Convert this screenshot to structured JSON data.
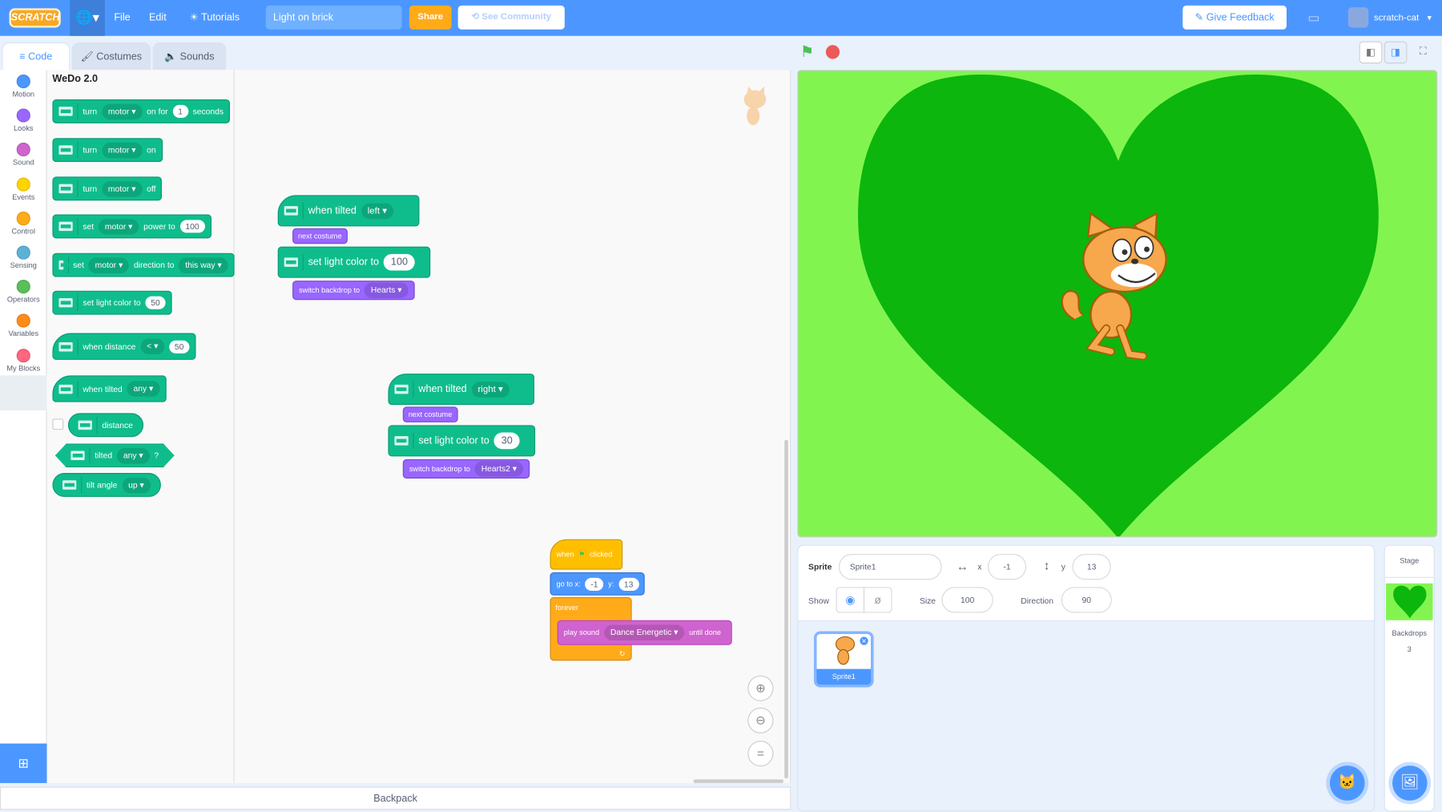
{
  "menu": {
    "logo": "Scratch",
    "file": "File",
    "edit": "Edit",
    "tutorials": "Tutorials",
    "project_title": "Light on brick",
    "share": "Share",
    "see_community": "See Community",
    "give_feedback": "Give Feedback",
    "username": "scratch-cat"
  },
  "tabs": {
    "code": "Code",
    "costumes": "Costumes",
    "sounds": "Sounds"
  },
  "categories": [
    {
      "label": "Motion",
      "color": "#4c97ff"
    },
    {
      "label": "Looks",
      "color": "#9966ff"
    },
    {
      "label": "Sound",
      "color": "#cf63cf"
    },
    {
      "label": "Events",
      "color": "#ffd500"
    },
    {
      "label": "Control",
      "color": "#ffab19"
    },
    {
      "label": "Sensing",
      "color": "#5cb1d6"
    },
    {
      "label": "Operators",
      "color": "#59c059"
    },
    {
      "label": "Variables",
      "color": "#ff8c1a"
    },
    {
      "label": "My Blocks",
      "color": "#ff6680"
    },
    {
      "label": "WeDo 2.0",
      "color": "#0fbd8c"
    }
  ],
  "palette": {
    "heading": "WeDo 2.0",
    "b1": {
      "a": "turn",
      "dd": "motor",
      "b": "on for",
      "num": "1",
      "c": "seconds"
    },
    "b2": {
      "a": "turn",
      "dd": "motor",
      "b": "on"
    },
    "b3": {
      "a": "turn",
      "dd": "motor",
      "b": "off"
    },
    "b4": {
      "a": "set",
      "dd": "motor",
      "b": "power to",
      "num": "100"
    },
    "b5": {
      "a": "set",
      "dd": "motor",
      "b": "direction to",
      "dd2": "this way"
    },
    "b6": {
      "a": "set light color to",
      "num": "50"
    },
    "b7": {
      "a": "when distance",
      "dd": "<",
      "num": "50"
    },
    "b8": {
      "a": "when tilted",
      "dd": "any"
    },
    "b9": {
      "a": "distance"
    },
    "b10": {
      "a": "tilted",
      "dd": "any",
      "b": "?"
    },
    "b11": {
      "a": "tilt angle",
      "dd": "up"
    }
  },
  "scripts": {
    "s1": {
      "hat": "when tilted",
      "hat_dd": "left",
      "looks": "next costume",
      "light": "set light color to",
      "light_num": "100",
      "backdrop": "switch backdrop to",
      "backdrop_dd": "Hearts"
    },
    "s2": {
      "hat": "when tilted",
      "hat_dd": "right",
      "looks": "next costume",
      "light": "set light color to",
      "light_num": "30",
      "backdrop": "switch backdrop to",
      "backdrop_dd": "Hearts2"
    },
    "s3": {
      "when": "when",
      "clicked": "clicked",
      "goto": "go to x:",
      "x": "-1",
      "y_label": "y:",
      "y": "13",
      "forever": "forever",
      "play": "play sound",
      "sound": "Dance Energetic",
      "until": "until done"
    }
  },
  "backpack": "Backpack",
  "sprite_info": {
    "sprite_label": "Sprite",
    "sprite_name": "Sprite1",
    "x_label": "x",
    "x": "-1",
    "y_label": "y",
    "y": "13",
    "show_label": "Show",
    "size_label": "Size",
    "size": "100",
    "direction_label": "Direction",
    "direction": "90"
  },
  "sprites": [
    {
      "name": "Sprite1",
      "selected": true
    }
  ],
  "stage_panel": {
    "label": "Stage",
    "backdrops_label": "Backdrops",
    "backdrops_count": "3"
  }
}
